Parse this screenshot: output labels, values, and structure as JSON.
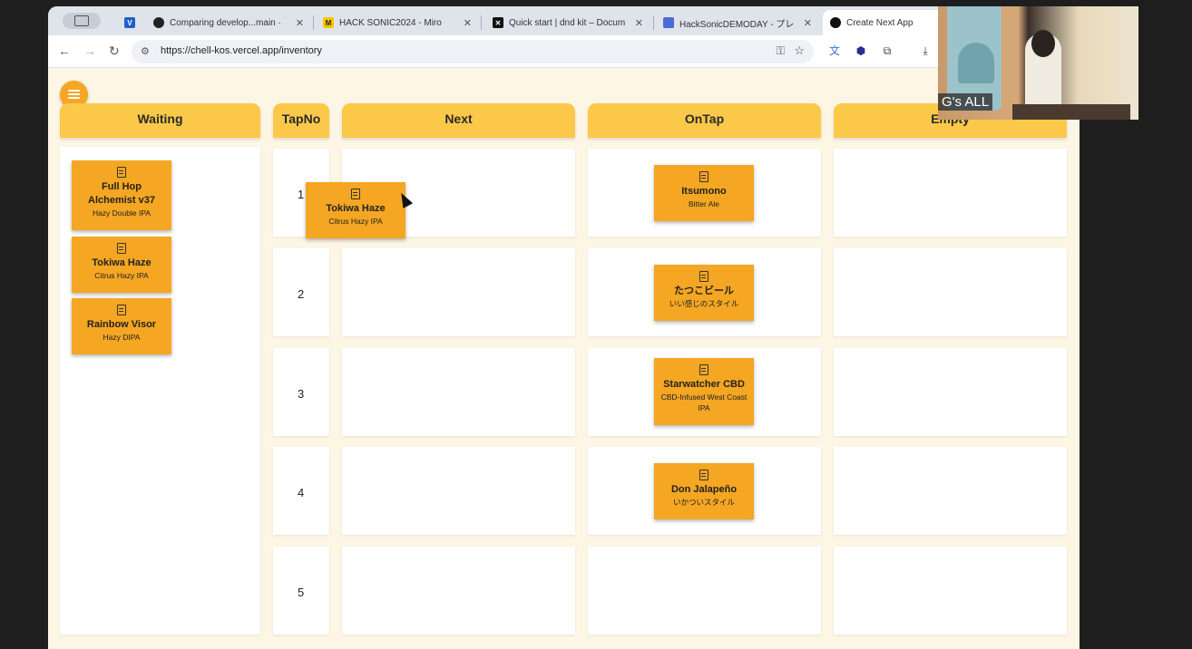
{
  "browser": {
    "tabs": [
      {
        "label": "Comparing develop...main · ",
        "favicon": "github"
      },
      {
        "label": "HACK SONIC2024 - Miro",
        "favicon": "miro"
      },
      {
        "label": "Quick start | dnd kit – Docum",
        "favicon": "dndkit"
      },
      {
        "label": "HackSonicDEMODAY - プレ",
        "favicon": "slides"
      },
      {
        "label": "Create Next App",
        "favicon": "nextjs",
        "active": true
      }
    ],
    "url": "https://chell-kos.vercel.app/inventory"
  },
  "board": {
    "columns": {
      "waiting": "Waiting",
      "tapno": "TapNo",
      "next": "Next",
      "ontap": "OnTap",
      "empty": "Empty"
    },
    "tap_numbers": [
      "1",
      "2",
      "3",
      "4",
      "5"
    ],
    "waiting_cards": [
      {
        "name": "Full Hop Alchemist v37",
        "style": "Hazy Double IPA"
      },
      {
        "name": "Tokiwa Haze",
        "style": "Citrus Hazy IPA"
      },
      {
        "name": "Rainbow Visor",
        "style": "Hazy DIPA"
      }
    ],
    "dragging_card": {
      "name": "Tokiwa Haze",
      "style": "Citrus Hazy IPA"
    },
    "ontap_cards": [
      {
        "tap": "1",
        "name": "Itsumono",
        "style": "Bitter Ale"
      },
      {
        "tap": "2",
        "name": "たつこビール",
        "style": "いい感じのスタイル"
      },
      {
        "tap": "3",
        "name": "Starwatcher CBD",
        "style": "CBD-Infused West Coast IPA"
      },
      {
        "tap": "4",
        "name": "Don Jalapeño",
        "style": "いかついスタイル"
      }
    ]
  },
  "video": {
    "participant": "G's ALL"
  },
  "overlay": {
    "logo": "zoom"
  },
  "colors": {
    "header": "#fcc84a",
    "card": "#f5a623",
    "background": "#fdf6e4"
  }
}
